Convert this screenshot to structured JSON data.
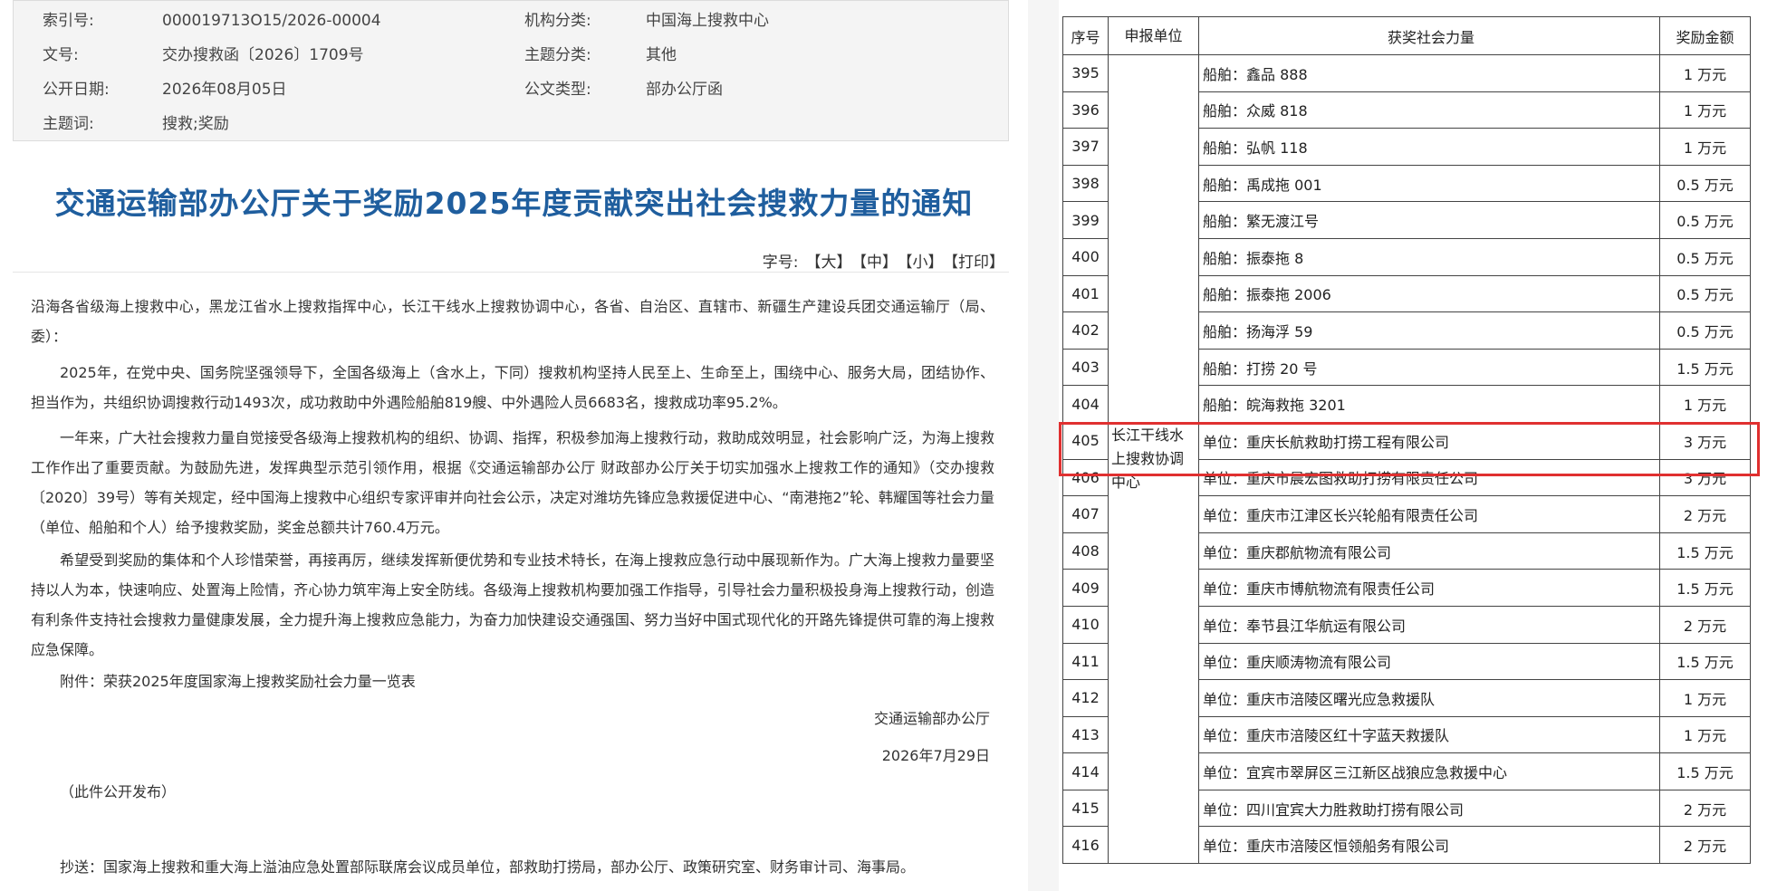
{
  "meta": {
    "rows": [
      {
        "k1": "索引号:",
        "v1": "000019713O15/2026-00004",
        "k2": "机构分类:",
        "v2": "中国海上搜救中心"
      },
      {
        "k1": "文号:",
        "v1": "交办搜救函〔2026〕1709号",
        "k2": "主题分类:",
        "v2": "其他"
      },
      {
        "k1": "公开日期:",
        "v1": "2026年08月05日",
        "k2": "公文类型:",
        "v2": "部办公厅函"
      },
      {
        "k1": "主题词:",
        "v1": "搜救;奖励",
        "k2": "",
        "v2": ""
      }
    ]
  },
  "title": "交通运输部办公厅关于奖励2025年度贡献突出社会搜救力量的通知",
  "font_size_bar": {
    "label": "字号:",
    "large": "【大】",
    "medium": "【中】",
    "small": "【小】",
    "print": "【打印】"
  },
  "body": {
    "salutation": "沿海各省级海上搜救中心，黑龙江省水上搜救指挥中心，长江干线水上搜救协调中心，各省、自治区、直辖市、新疆生产建设兵团交通运输厅（局、委）：",
    "p1": "2025年，在党中央、国务院坚强领导下，全国各级海上（含水上，下同）搜救机构坚持人民至上、生命至上，围绕中心、服务大局，团结协作、担当作为，共组织协调搜救行动1493次，成功救助中外遇险船舶819艘、中外遇险人员6683名，搜救成功率95.2%。",
    "p2": "一年来，广大社会搜救力量自觉接受各级海上搜救机构的组织、协调、指挥，积极参加海上搜救行动，救助成效明显，社会影响广泛，为海上搜救工作作出了重要贡献。为鼓励先进，发挥典型示范引领作用，根据《交通运输部办公厅 财政部办公厅关于切实加强水上搜救工作的通知》（交办搜救〔2020〕39号）等有关规定，经中国海上搜救中心组织专家评审并向社会公示，决定对潍坊先锋应急救援促进中心、“南港拖2”轮、韩耀国等社会力量（单位、船舶和个人）给予搜救奖励，奖金总额共计760.4万元。",
    "p3": "希望受到奖励的集体和个人珍惜荣誉，再接再厉，继续发挥新便优势和专业技术特长，在海上搜救应急行动中展现新作为。广大海上搜救力量要坚持以人为本，快速响应、处置海上险情，齐心协力筑牢海上安全防线。各级海上搜救机构要加强工作指导，引导社会力量积极投身海上搜救行动，创造有利条件支持社会搜救力量健康发展，全力提升海上搜救应急能力，为奋力加快建设交通强国、努力当好中国式现代化的开路先锋提供可靠的海上搜救应急保障。",
    "attachment": "附件：荣获2025年度国家海上搜救奖励社会力量一览表",
    "signer": "交通运输部办公厅",
    "date": "2026年7月29日",
    "public_note": "（此件公开发布）",
    "cc": "抄送：国家海上搜救和重大海上溢油应急处置部际联席会议成员单位，部救助打捞局，部办公厅、政策研究室、财务审计司、海事局。"
  },
  "table": {
    "headers": [
      "序号",
      "申报单位",
      "获奖社会力量",
      "奖励金额"
    ],
    "unit": "长江干线水上搜救协调中心",
    "rows": [
      [
        "395",
        "船舶：鑫品 888",
        "1 万元"
      ],
      [
        "396",
        "船舶：众威 818",
        "1 万元"
      ],
      [
        "397",
        "船舶：弘帆 118",
        "1 万元"
      ],
      [
        "398",
        "船舶：禹成拖 001",
        "0.5 万元"
      ],
      [
        "399",
        "船舶：繁无渡江号",
        "0.5 万元"
      ],
      [
        "400",
        "船舶：振泰拖 8",
        "0.5 万元"
      ],
      [
        "401",
        "船舶：振泰拖 2006",
        "0.5 万元"
      ],
      [
        "402",
        "船舶：扬海浮 59",
        "0.5 万元"
      ],
      [
        "403",
        "船舶：打捞 20 号",
        "1.5 万元"
      ],
      [
        "404",
        "船舶：皖海救拖 3201",
        "1 万元"
      ],
      [
        "405",
        "单位：重庆长航救助打捞工程有限公司",
        "3 万元"
      ],
      [
        "406",
        "单位：重庆市晨宏图救助打捞有限责任公司",
        "3 万元"
      ],
      [
        "407",
        "单位：重庆市江津区长兴轮船有限责任公司",
        "2 万元"
      ],
      [
        "408",
        "单位：重庆郡航物流有限公司",
        "1.5 万元"
      ],
      [
        "409",
        "单位：重庆市博航物流有限责任公司",
        "1.5 万元"
      ],
      [
        "410",
        "单位：奉节县江华航运有限公司",
        "2 万元"
      ],
      [
        "411",
        "单位：重庆顺涛物流有限公司",
        "1.5 万元"
      ],
      [
        "412",
        "单位：重庆市涪陵区曙光应急救援队",
        "1 万元"
      ],
      [
        "413",
        "单位：重庆市涪陵区红十字蓝天救援队",
        "1 万元"
      ],
      [
        "414",
        "单位：宜宾市翠屏区三江新区战狼应急救援中心",
        "1.5 万元"
      ],
      [
        "415",
        "单位：四川宜宾大力胜救助打捞有限公司",
        "2 万元"
      ],
      [
        "416",
        "单位：重庆市涪陵区恒领船务有限公司",
        "2 万元"
      ]
    ],
    "highlight_color": "#e03030"
  }
}
